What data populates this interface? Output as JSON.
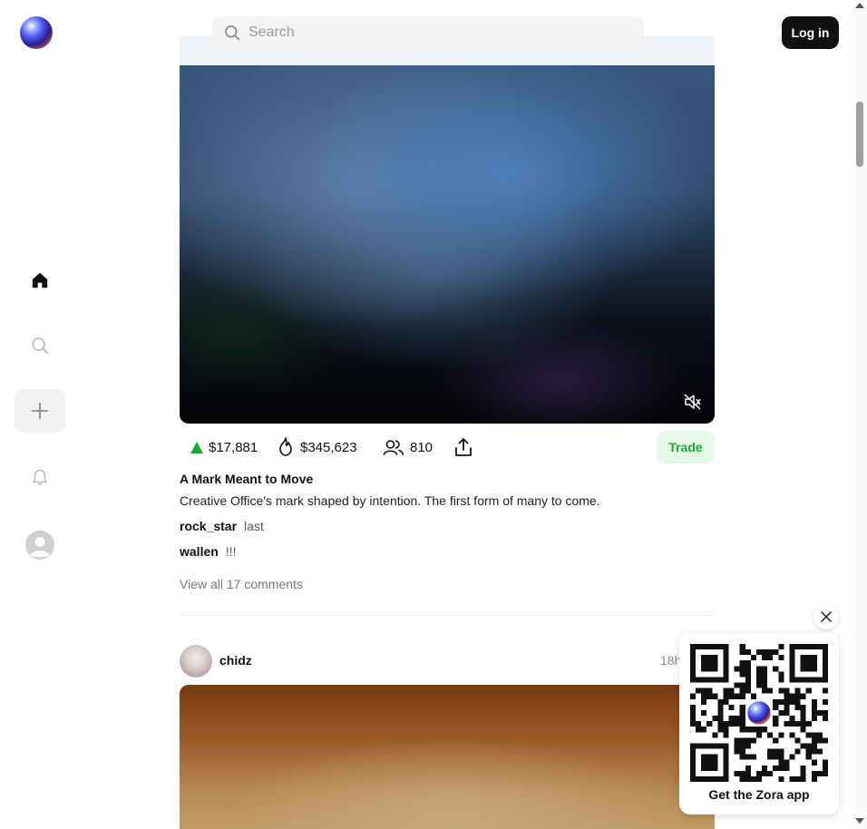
{
  "header": {
    "search_placeholder": "Search",
    "login_label": "Log in"
  },
  "sidebar": {
    "items": [
      {
        "icon": "home-icon"
      },
      {
        "icon": "search-icon"
      },
      {
        "icon": "plus-icon"
      },
      {
        "icon": "bell-icon"
      },
      {
        "icon": "profile-avatar-icon"
      }
    ]
  },
  "post": {
    "stats": {
      "market_cap": "$17,881",
      "volume": "$345,623",
      "holders": "810"
    },
    "trade_label": "Trade",
    "title": "A Mark Meant to Move",
    "description": "Creative Office's mark shaped by intention. The first form of many to come.",
    "comments": [
      {
        "user": "rock_star",
        "text": "last"
      },
      {
        "user": "wallen",
        "text": "!!!"
      }
    ],
    "view_all_label": "View all 17 comments"
  },
  "next_post": {
    "author": "chidz",
    "time": "18h"
  },
  "qr_popup": {
    "label": "Get the Zora app"
  },
  "colors": {
    "accent_green": "#19a832",
    "trade_bg": "#e6f8e6",
    "login_bg": "#111111"
  }
}
